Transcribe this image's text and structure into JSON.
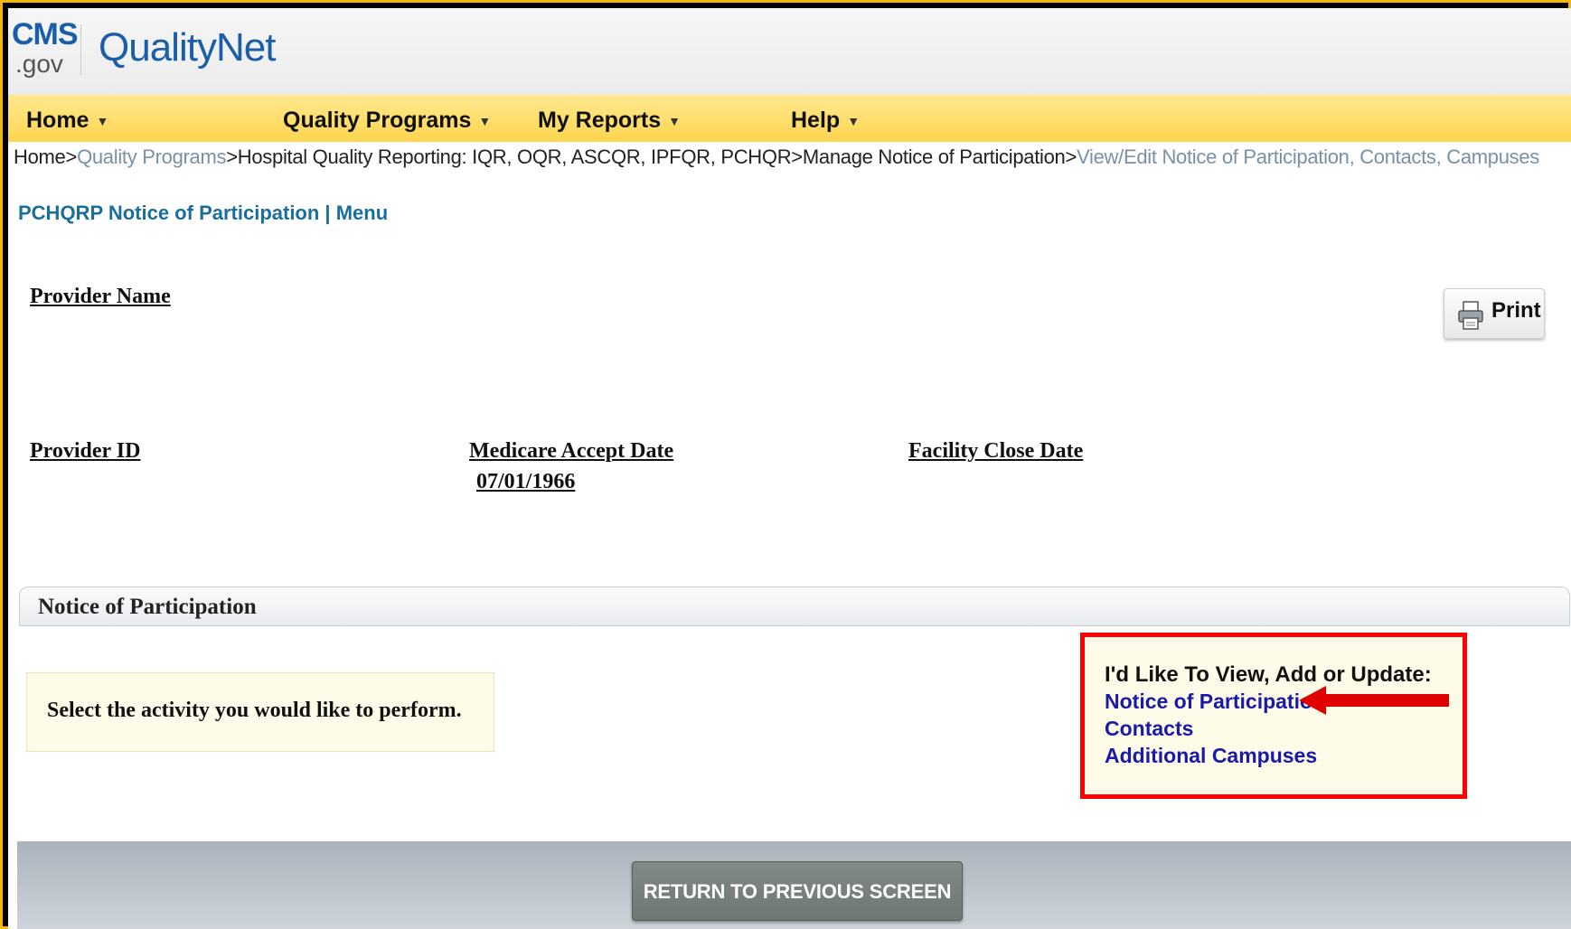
{
  "header": {
    "logo_cms": "CMS",
    "logo_gov": ".gov",
    "logo_site": "QualityNet"
  },
  "nav": {
    "items": [
      {
        "label": "Home"
      },
      {
        "label": "Quality Programs"
      },
      {
        "label": "My Reports"
      },
      {
        "label": "Help"
      }
    ]
  },
  "breadcrumb": {
    "items": [
      {
        "label": "Home"
      },
      {
        "label": "Quality Programs"
      },
      {
        "label": "Hospital Quality Reporting: IQR, OQR, ASCQR, IPFQR, PCHQR"
      },
      {
        "label": "Manage Notice of Participation"
      },
      {
        "label": "View/Edit Notice of Participation, Contacts, Campuses"
      }
    ],
    "separator": ">"
  },
  "section_title": "PCHQRP Notice of Participation | Menu",
  "provider": {
    "name_label": "Provider Name",
    "id_label": "Provider ID",
    "medicare_accept_date_label": "Medicare Accept Date",
    "medicare_accept_date_value": "07/01/1966",
    "facility_close_date_label": "Facility Close Date"
  },
  "print_button": {
    "label": "Print",
    "icon": "printer-icon"
  },
  "panel": {
    "title": "Notice of Participation",
    "instruction": "Select the activity you would like to perform.",
    "action_heading": "I'd Like To View, Add or Update:",
    "links": [
      {
        "label": "Notice of Participation"
      },
      {
        "label": "Contacts"
      },
      {
        "label": "Additional Campuses"
      }
    ]
  },
  "footer": {
    "return_button_label": "RETURN TO PREVIOUS SCREEN"
  },
  "colors": {
    "frame_border": "#f5b800",
    "nav_bg": "#ffd54f",
    "highlight_box": "#ff0000",
    "link_color": "#1a1aa8",
    "section_title": "#1a6f9a"
  }
}
